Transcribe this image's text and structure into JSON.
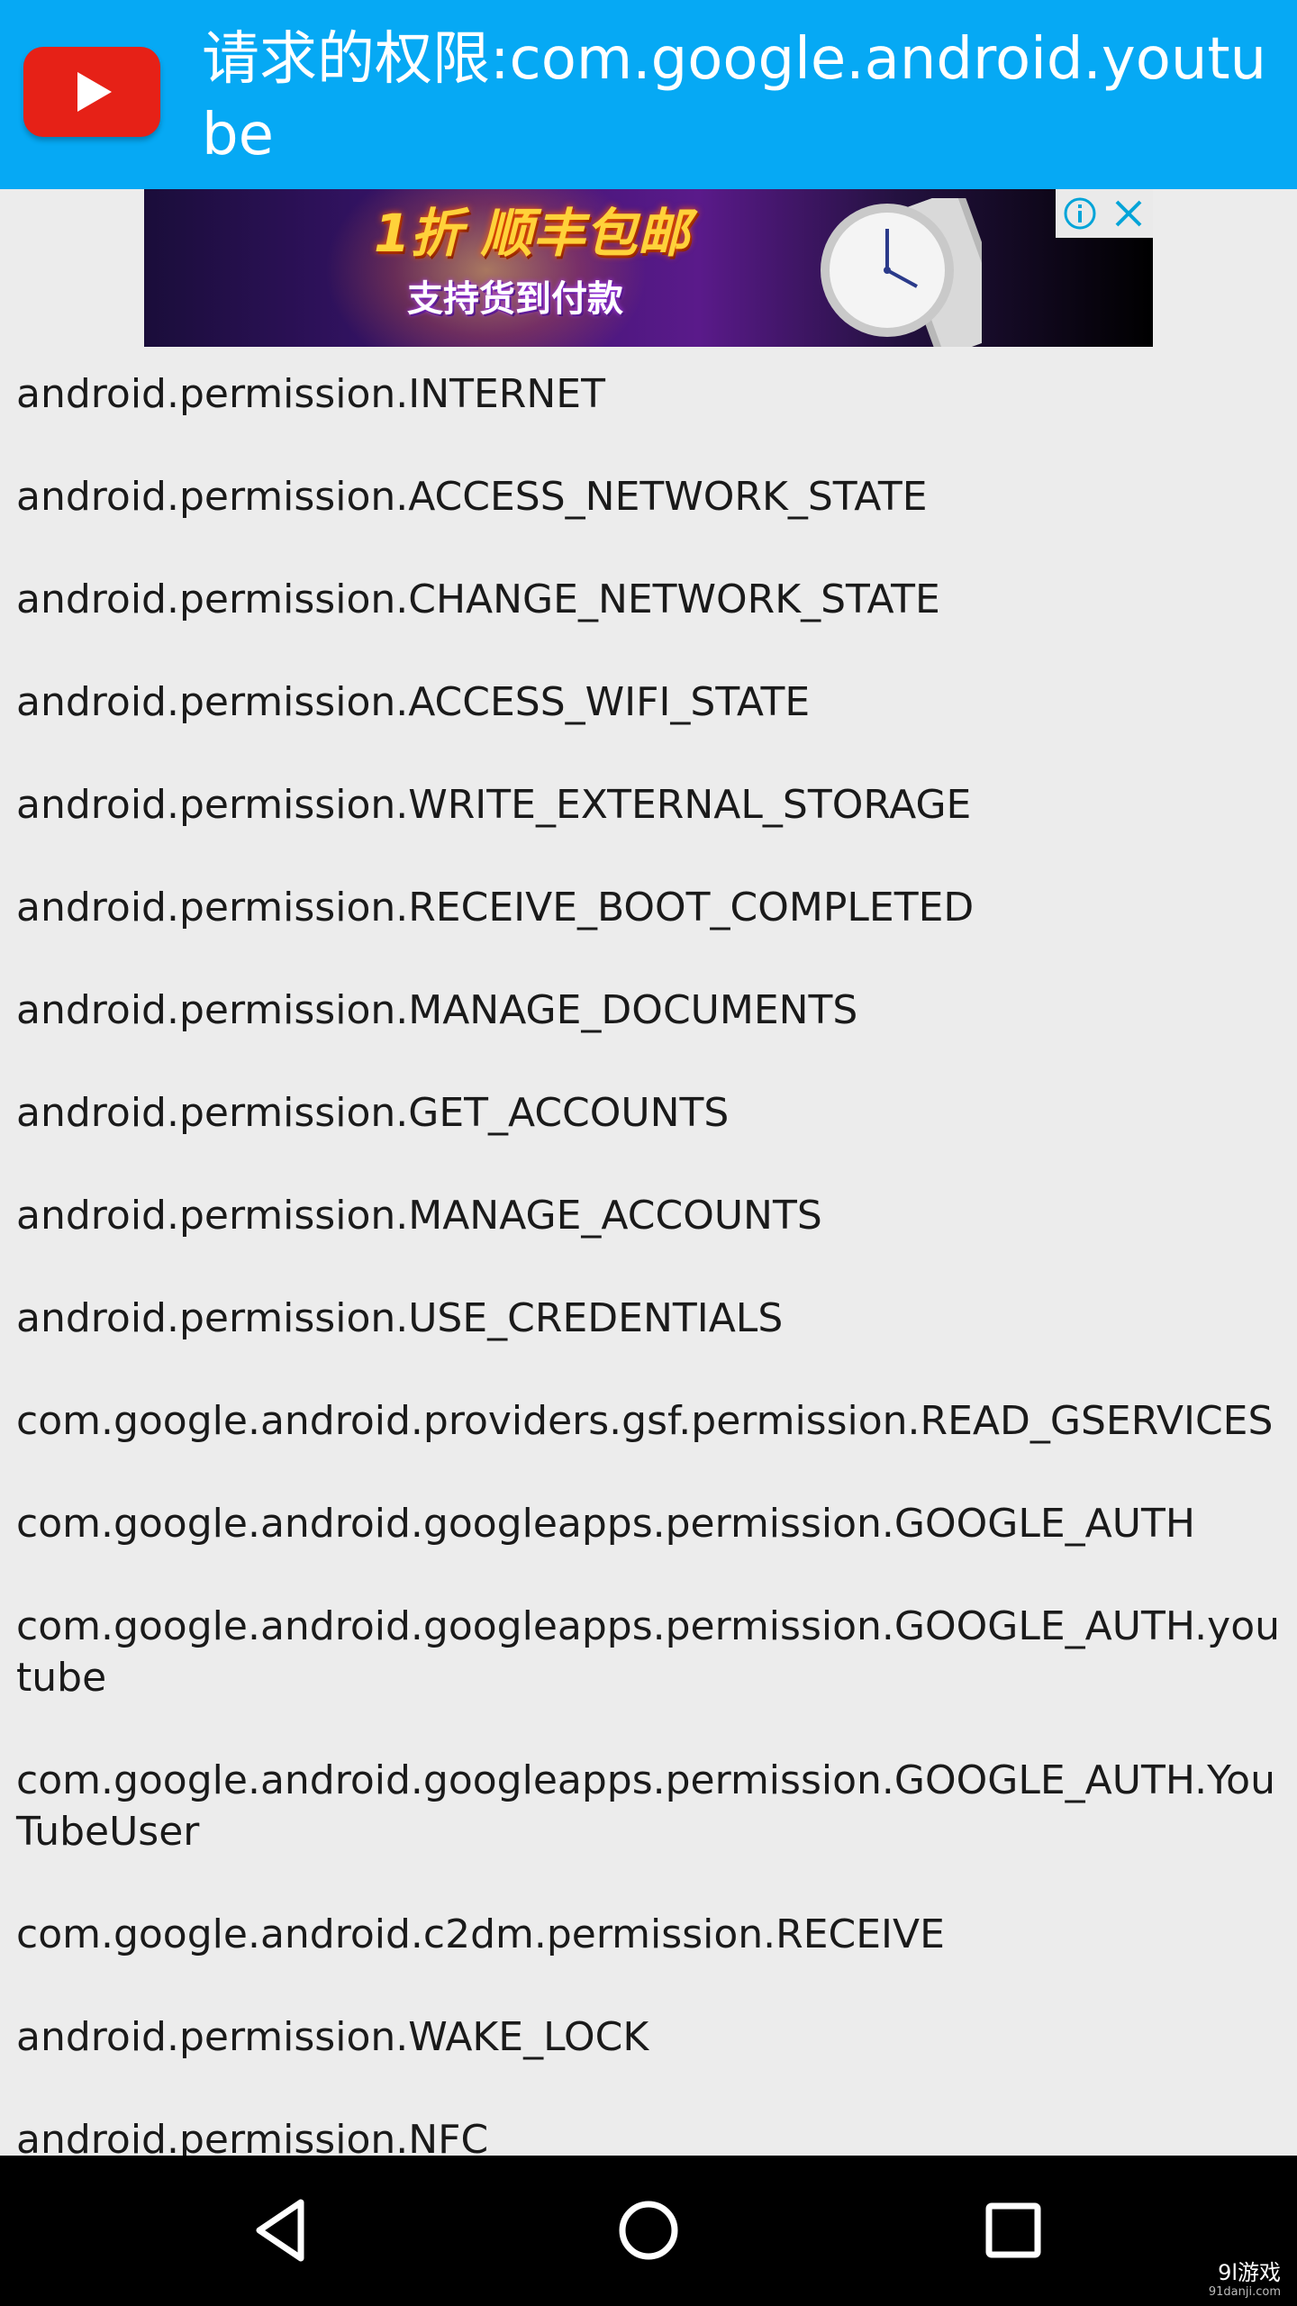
{
  "header": {
    "title": "请求的权限:com.google.android.youtube",
    "app_icon": "youtube-icon",
    "background_color": "#06a9f4"
  },
  "ad": {
    "headline": "1折 顺丰包邮",
    "subtext": "支持货到付款",
    "info_icon": "info-icon",
    "close_icon": "close-icon",
    "control_color": "#00a4d8"
  },
  "permissions": [
    "android.permission.INTERNET",
    "android.permission.ACCESS_NETWORK_STATE",
    "android.permission.CHANGE_NETWORK_STATE",
    "android.permission.ACCESS_WIFI_STATE",
    "android.permission.WRITE_EXTERNAL_STORAGE",
    "android.permission.RECEIVE_BOOT_COMPLETED",
    "android.permission.MANAGE_DOCUMENTS",
    "android.permission.GET_ACCOUNTS",
    "android.permission.MANAGE_ACCOUNTS",
    "android.permission.USE_CREDENTIALS",
    "com.google.android.providers.gsf.permission.READ_GSERVICES",
    "com.google.android.googleapps.permission.GOOGLE_AUTH",
    "com.google.android.googleapps.permission.GOOGLE_AUTH.youtube",
    "com.google.android.googleapps.permission.GOOGLE_AUTH.YouTubeUser",
    "com.google.android.c2dm.permission.RECEIVE",
    "android.permission.WAKE_LOCK",
    "android.permission.NFC"
  ],
  "nav": {
    "back_icon": "back-icon",
    "home_icon": "home-icon",
    "recents_icon": "recents-icon"
  },
  "watermark": {
    "brand": "9l游戏",
    "url": "91danji.com"
  }
}
